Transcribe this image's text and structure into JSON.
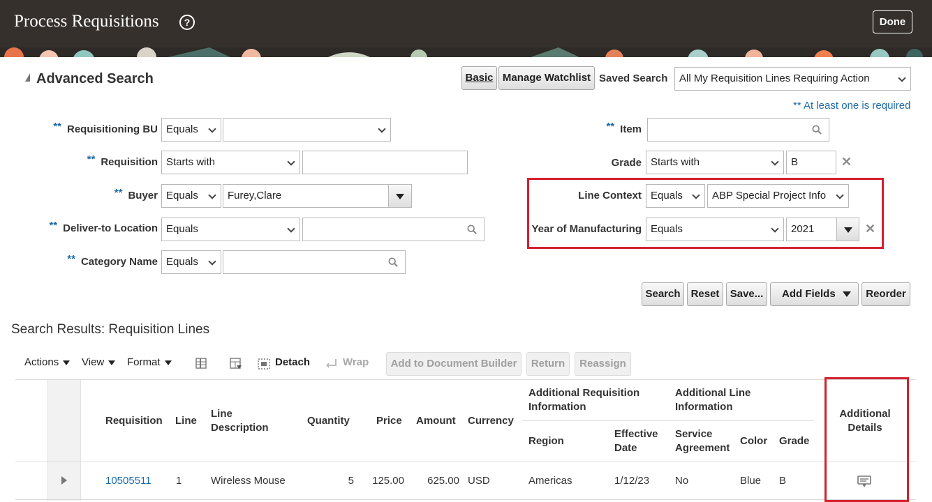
{
  "header": {
    "title": "Process Requisitions",
    "help": "?",
    "done_label": "Done"
  },
  "advanced_search": {
    "title": "Advanced Search",
    "basic_label": "Basic",
    "manage_watchlist_label": "Manage Watchlist",
    "saved_search_label": "Saved Search",
    "saved_search_value": "All My Requisition Lines Requiring Action",
    "required_hint": "** At least one is required",
    "required_marker": "**",
    "fields": {
      "requisitioning_bu": {
        "label": "Requisitioning BU",
        "operator": "Equals",
        "value": ""
      },
      "requisition": {
        "label": "Requisition",
        "operator": "Starts with",
        "value": ""
      },
      "buyer": {
        "label": "Buyer",
        "operator": "Equals",
        "value": "Furey,Clare"
      },
      "deliver_to": {
        "label": "Deliver-to Location",
        "operator": "Equals",
        "value": ""
      },
      "category": {
        "label": "Category Name",
        "operator": "Equals",
        "value": ""
      },
      "item": {
        "label": "Item",
        "value": ""
      },
      "grade": {
        "label": "Grade",
        "operator": "Starts with",
        "value": "B"
      },
      "line_context": {
        "label": "Line Context",
        "operator": "Equals",
        "value": "ABP Special Project Info"
      },
      "year_of_manufacturing": {
        "label": "Year of Manufacturing",
        "operator": "Equals",
        "value": "2021"
      }
    },
    "buttons": {
      "search": "Search",
      "reset": "Reset",
      "save": "Save...",
      "add_fields": "Add Fields",
      "reorder": "Reorder"
    }
  },
  "results": {
    "title": "Search Results: Requisition Lines",
    "toolbar": {
      "actions": "Actions",
      "view": "View",
      "format": "Format",
      "detach": "Detach",
      "wrap": "Wrap",
      "add_doc_builder": "Add to Document Builder",
      "return": "Return",
      "reassign": "Reassign"
    },
    "columns": {
      "requisition": "Requisition",
      "line": "Line",
      "line_desc_1": "Line",
      "line_desc_2": "Description",
      "quantity": "Quantity",
      "price": "Price",
      "amount": "Amount",
      "currency": "Currency",
      "add_req_info_1": "Additional Requisition",
      "add_req_info_2": "Information",
      "region": "Region",
      "eff_date_1": "Effective",
      "eff_date_2": "Date",
      "add_line_info_1": "Additional Line",
      "add_line_info_2": "Information",
      "service_1": "Service",
      "service_2": "Agreement",
      "color": "Color",
      "grade": "Grade",
      "add_details_1": "Additional",
      "add_details_2": "Details"
    },
    "rows": [
      {
        "requisition": "10505511",
        "line": "1",
        "line_description": "Wireless Mouse",
        "quantity": "5",
        "price": "125.00",
        "amount": "625.00",
        "currency": "USD",
        "region": "Americas",
        "effective_date": "1/12/23",
        "service_agreement": "No",
        "color": "Blue",
        "grade": "B"
      }
    ]
  }
}
